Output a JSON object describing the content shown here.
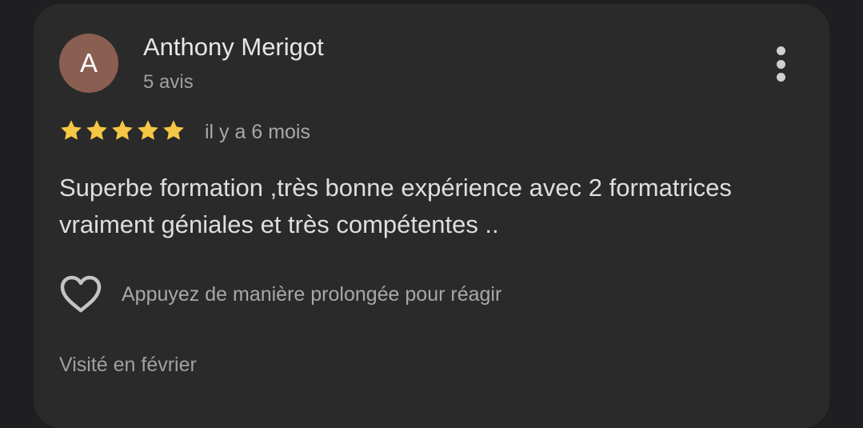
{
  "review": {
    "avatar_letter": "A",
    "author_name": "Anthony Merigot",
    "review_count": "5 avis",
    "rating": 5,
    "time_ago": "il y a 6 mois",
    "text": "Superbe formation ,très bonne expérience avec 2 formatrices vraiment géniales et très compétentes ..",
    "react_hint": "Appuyez de manière prolongée pour réagir",
    "visit_info": "Visité en février"
  },
  "icons": {
    "more": "more-vert-icon",
    "star": "star-icon",
    "heart": "heart-outline-icon"
  },
  "colors": {
    "background": "#1f1f21",
    "card": "#2a2a2b",
    "avatar": "#8b5e52",
    "star": "#f6c744"
  }
}
